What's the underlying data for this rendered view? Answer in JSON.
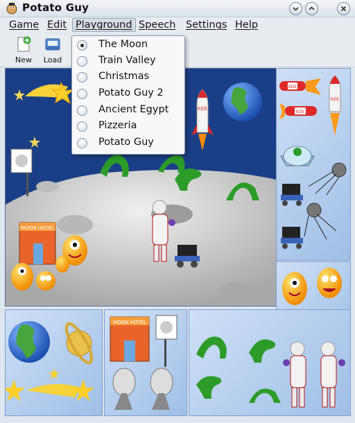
{
  "window": {
    "title": "Potato Guy"
  },
  "menubar": {
    "items": [
      "Game",
      "Edit",
      "Playground",
      "Speech",
      "Settings",
      "Help"
    ],
    "active": "Playground"
  },
  "toolbar": {
    "new_label": "New",
    "load_label": "Load"
  },
  "playground_menu": {
    "items": [
      {
        "label": "The Moon",
        "checked": true
      },
      {
        "label": "Train Valley",
        "checked": false
      },
      {
        "label": "Christmas",
        "checked": false
      },
      {
        "label": "Potato Guy 2",
        "checked": false
      },
      {
        "label": "Ancient Egypt",
        "checked": false
      },
      {
        "label": "Pizzeria",
        "checked": false
      },
      {
        "label": "Potato Guy",
        "checked": false
      }
    ]
  },
  "scene": {
    "hotel_sign": "MOON HOTEL",
    "rocket_text": "KDE",
    "icons": [
      "star-icon",
      "comet-icon",
      "earth-icon",
      "rocket-icon",
      "moon-crater",
      "alien-tentacle-icon",
      "astronaut-icon",
      "moon-rover-icon",
      "potato-alien-icon",
      "satellite-icon",
      "saturn-icon",
      "satellite-dish-icon",
      "flag-sign-icon"
    ]
  },
  "colors": {
    "space": "#1b3f86",
    "moon": "#c8c8c8",
    "panel": "#b9d0ef",
    "alien": "#2d9b2a",
    "potato": "#f5a21a"
  }
}
